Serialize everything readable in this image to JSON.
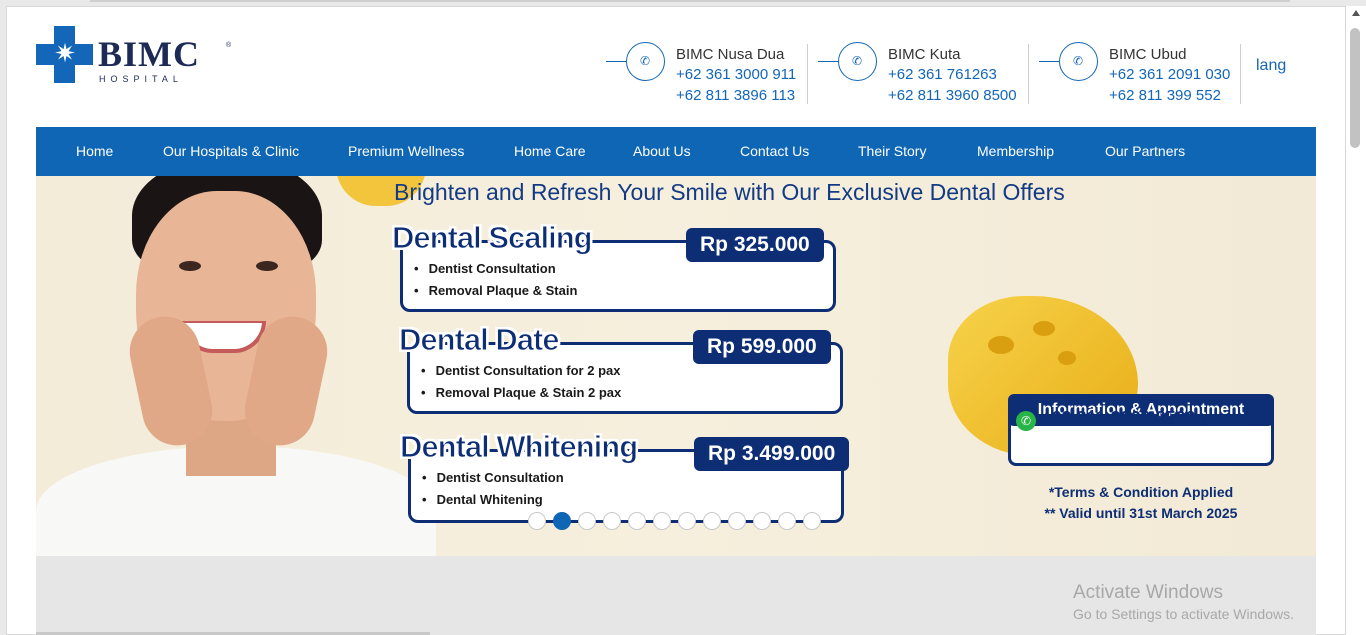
{
  "brand": {
    "name": "BIMC",
    "registered": "®",
    "subtitle": "HOSPITAL"
  },
  "contacts": [
    {
      "name": "BIMC Nusa Dua",
      "phone1": "+62 361 3000 911",
      "phone2": "+62 811 3896 113",
      "icon": "phone-icon"
    },
    {
      "name": "BIMC Kuta",
      "phone1": "+62 361 761263",
      "phone2": "+62 811 3960 8500",
      "icon": "phone-icon"
    },
    {
      "name": "BIMC Ubud",
      "phone1": "+62 361 2091 030",
      "phone2": "+62 811 399 552",
      "icon": "phone-icon"
    }
  ],
  "lang": {
    "label": "lang",
    "icon_glyph": ""
  },
  "nav": {
    "items": [
      {
        "label": "Home"
      },
      {
        "label": "Our Hospitals & Clinic "
      },
      {
        "label": "Premium Wellness"
      },
      {
        "label": "Home Care"
      },
      {
        "label": "About Us "
      },
      {
        "label": "Contact Us "
      },
      {
        "label": "Their Story "
      },
      {
        "label": "Membership "
      },
      {
        "label": "Our Partners "
      }
    ],
    "search_glyph": ""
  },
  "hero": {
    "headline": "Brighten and Refresh Your Smile with Our Exclusive Dental Offers",
    "offers": [
      {
        "title": "Dental Scaling",
        "price": "Rp 325.000",
        "items": [
          "Dentist Consultation",
          "Removal Plaque & Stain"
        ]
      },
      {
        "title": "Dental Date",
        "price": "Rp 599.000",
        "items": [
          "Dentist Consultation for 2 pax",
          "Removal Plaque & Stain 2 pax"
        ]
      },
      {
        "title": "Dental Whitening",
        "price": "Rp 3.499.000",
        "items": [
          "Dentist Consultation",
          "Dental Whitening"
        ]
      }
    ],
    "info": {
      "header": "Information & Appointment",
      "phone": "+62 811 3960 8500",
      "note": "(Text Only)"
    },
    "terms": "*Terms & Condition Applied",
    "valid": "** Valid until 31st March 2025",
    "slider": {
      "total": 12,
      "active": 2
    }
  },
  "activate": {
    "title": "Activate Windows",
    "subtitle": "Go to Settings to activate Windows."
  },
  "colors": {
    "brand_blue": "#0e66b5",
    "navy": "#0d2d75",
    "hero_bg": "#f3ecd9"
  }
}
